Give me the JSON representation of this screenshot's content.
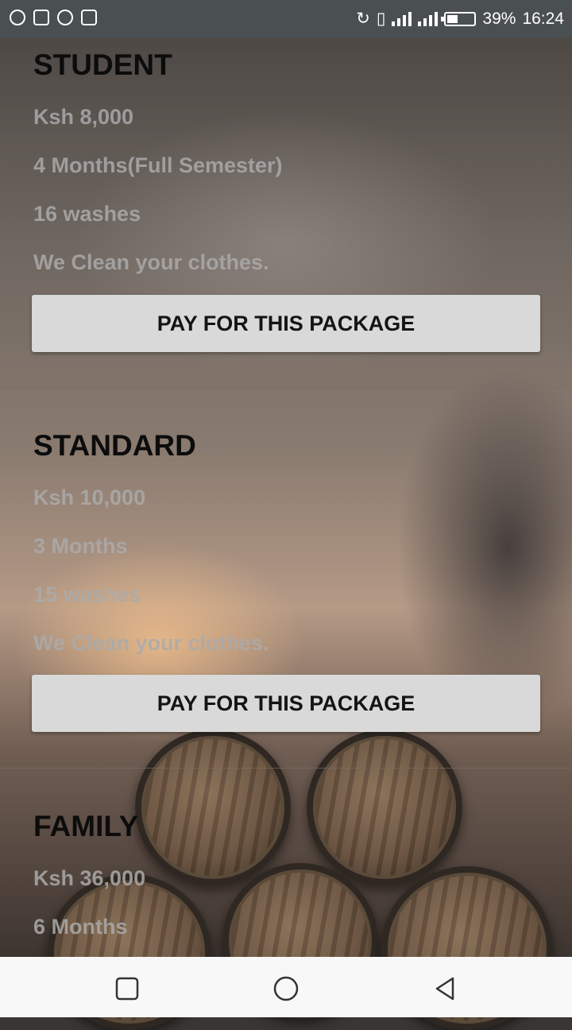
{
  "status_bar": {
    "left_icons": [
      "chat-bubble-icon",
      "sim-icon",
      "data-saver-icon",
      "cast-icon"
    ],
    "battery_percent": 39,
    "battery_label": "39%",
    "time": "16:24"
  },
  "packages": [
    {
      "title": "STUDENT",
      "price": "Ksh 8,000",
      "duration": "4 Months(Full Semester)",
      "washes": "16 washes",
      "description": "We Clean your clothes.",
      "button_label": "PAY FOR THIS PACKAGE"
    },
    {
      "title": "STANDARD",
      "price": " Ksh 10,000",
      "duration": "3 Months",
      "washes": "15 washes",
      "description": "We Clean your clothes.",
      "button_label": "PAY FOR THIS PACKAGE"
    },
    {
      "title": "FAMILY",
      "price": "Ksh 36,000",
      "duration": "6 Months"
    }
  ],
  "nav_bar": {
    "buttons": [
      "recents-square-icon",
      "home-circle-icon",
      "back-triangle-icon"
    ]
  },
  "colors": {
    "status_bar": "#4a4f52",
    "button_bg": "#d8d9d8",
    "title_text": "#0c0c0c",
    "detail_text": "#aaaaaa",
    "nav_bar": "#f8f8f8"
  }
}
